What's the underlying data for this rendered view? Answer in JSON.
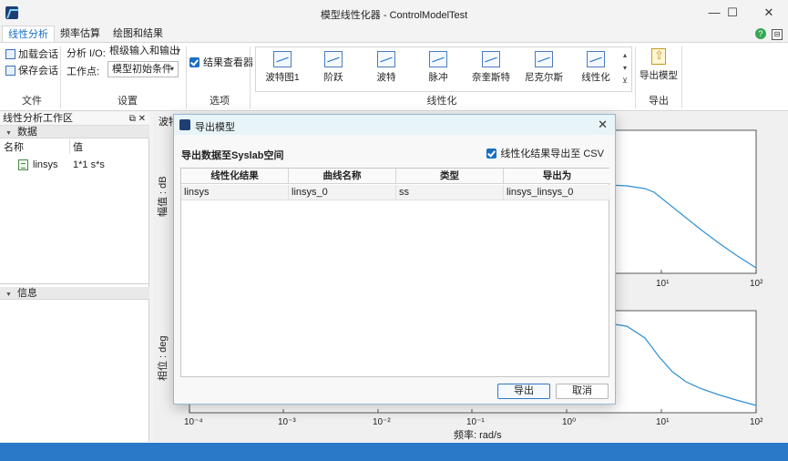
{
  "window": {
    "title": "模型线性化器 - ControlModelTest",
    "minimize": "—",
    "maximize": "☐",
    "close": "✕"
  },
  "ribbon_tabs": [
    "线性分析",
    "频率估算",
    "绘图和结果"
  ],
  "file_group": {
    "label": "文件",
    "load": "加载会话",
    "save": "保存会话"
  },
  "settings_group": {
    "label": "设置",
    "io_label": "分析 I/O:",
    "io_value": "根级输入和输出",
    "op_label": "工作点:",
    "op_value": "模型初始条件"
  },
  "options_group": {
    "label": "选项",
    "result_viewer": "结果查看器"
  },
  "linearize_group": {
    "label": "线性化",
    "buttons": [
      "波特图1",
      "阶跃",
      "波特",
      "脉冲",
      "奈奎斯特",
      "尼克尔斯",
      "线性化"
    ]
  },
  "export_group": {
    "label": "导出",
    "button": "导出模型"
  },
  "left_panel": {
    "title": "线性分析工作区",
    "data_section": "数据",
    "col_name": "名称",
    "col_value": "值",
    "variable_name": "linsys",
    "variable_value": "1*1 s*s",
    "info_section": "信息"
  },
  "plot": {
    "tab_label": "波特",
    "mag_ylabel": "幅值 : dB",
    "phase_ylabel": "相位 : deg",
    "xlabel": "频率: rad/s",
    "ticks_top": [
      "10¹",
      "10²"
    ],
    "ticks_bottom": [
      "10⁻⁴",
      "10⁻³",
      "10⁻²",
      "10⁻¹",
      "10⁰",
      "10¹",
      "10²"
    ]
  },
  "dialog": {
    "title": "导出模型",
    "heading": "导出数据至Syslab空间",
    "csv_option": "线性化结果导出至 CSV",
    "columns": [
      "线性化结果",
      "曲线名称",
      "类型",
      "导出为"
    ],
    "row": [
      "linsys",
      "linsys_0",
      "ss",
      "linsys_linsys_0"
    ],
    "export_button": "导出",
    "cancel_button": "取消"
  },
  "colors": {
    "accent": "#1a6fc2",
    "status_bar": "#2a78c8",
    "curve": "#2f8fd3"
  }
}
